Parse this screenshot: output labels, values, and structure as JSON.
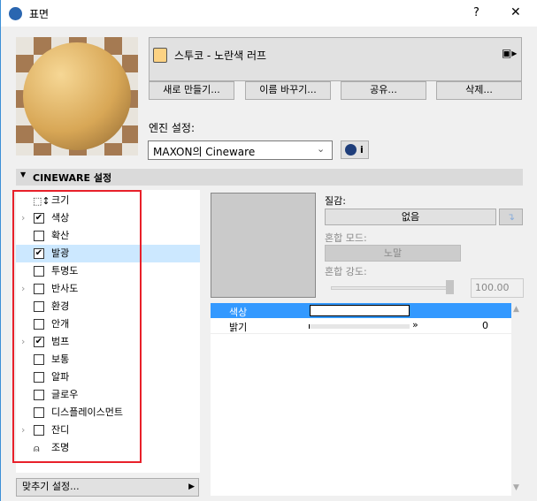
{
  "window": {
    "title": "표면",
    "help": "?",
    "close": "✕"
  },
  "material": {
    "name": "스투코 - 노란색 러프",
    "swatch": "#fcd283"
  },
  "buttons": {
    "new": "새로 만들기...",
    "rename": "이름 바꾸기...",
    "share": "공유...",
    "delete": "삭제..."
  },
  "engine": {
    "label": "엔진 설정:",
    "value": "MAXON의 Cineware",
    "info": "i"
  },
  "section": {
    "title": "CINEWARE 설정"
  },
  "channels": [
    {
      "label": "크기",
      "type": "size",
      "checked": false,
      "expandable": false
    },
    {
      "label": "색상",
      "type": "check",
      "checked": true,
      "expandable": true
    },
    {
      "label": "확산",
      "type": "check",
      "checked": false,
      "expandable": false
    },
    {
      "label": "발광",
      "type": "check",
      "checked": true,
      "expandable": false,
      "selected": true
    },
    {
      "label": "투명도",
      "type": "check",
      "checked": false,
      "expandable": false
    },
    {
      "label": "반사도",
      "type": "check",
      "checked": false,
      "expandable": true
    },
    {
      "label": "환경",
      "type": "check",
      "checked": false,
      "expandable": false
    },
    {
      "label": "안개",
      "type": "check",
      "checked": false,
      "expandable": false
    },
    {
      "label": "범프",
      "type": "check",
      "checked": true,
      "expandable": true
    },
    {
      "label": "보통",
      "type": "check",
      "checked": false,
      "expandable": false
    },
    {
      "label": "알파",
      "type": "check",
      "checked": false,
      "expandable": false
    },
    {
      "label": "글로우",
      "type": "check",
      "checked": false,
      "expandable": false
    },
    {
      "label": "디스플레이스먼트",
      "type": "check",
      "checked": false,
      "expandable": false
    },
    {
      "label": "잔디",
      "type": "check",
      "checked": false,
      "expandable": true
    },
    {
      "label": "조명",
      "type": "light",
      "checked": false,
      "expandable": false
    }
  ],
  "fit": {
    "label": "맞추기 설정..."
  },
  "texture": {
    "label": "질감:",
    "value": "없음",
    "blend_mode_label": "혼합 모드:",
    "blend_mode": "노말",
    "blend_strength_label": "혼합 강도:",
    "blend_strength": "100.00",
    "slider_fraction": 1.0
  },
  "params": [
    {
      "name": "색상",
      "value": ""
    },
    {
      "name": "밝기",
      "value": "0"
    }
  ]
}
